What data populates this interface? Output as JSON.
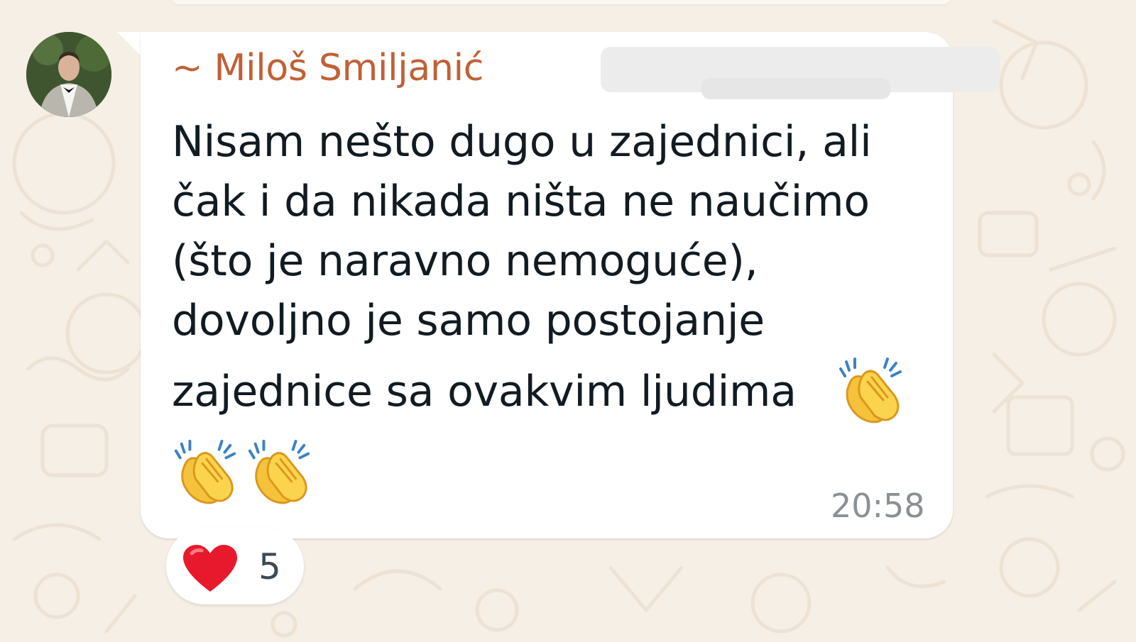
{
  "chat": {
    "message": {
      "sender": "~ Miloš Smiljanić",
      "lines": [
        "Nisam nešto dugo u zajednici, ali",
        "čak i da nikada ništa ne naučimo",
        "(što je naravno nemoguće),",
        "dovoljno je samo postojanje",
        "zajednice sa ovakvim ljudima"
      ],
      "emoji_name": "clapping-hands-emoji",
      "time": "20:58"
    },
    "reaction": {
      "emoji_name": "red-heart-emoji",
      "count": "5"
    }
  },
  "colors": {
    "background": "#f5efe6",
    "sender_name": "#c06037",
    "bubble": "#ffffff",
    "text": "#111b21",
    "timestamp": "#8a9094"
  }
}
